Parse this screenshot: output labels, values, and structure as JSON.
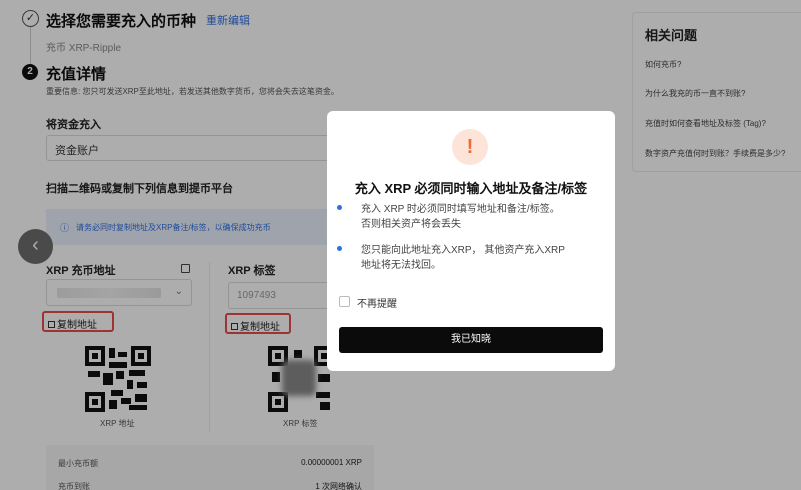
{
  "steps": {
    "step1": {
      "title": "选择您需要充入的币种",
      "edit_link": "重新编辑",
      "selected": "充币 XRP-Ripple"
    },
    "step2": {
      "number": "2",
      "title": "充值详情",
      "notice": "重要信息: 您只可发送XRP至此地址，若发送其他数字货币，您将会失去这笔资金。"
    }
  },
  "deposit_to": {
    "label": "将资金充入",
    "value": "资金账户"
  },
  "scan_label": "扫描二维码或复制下列信息到提币平台",
  "info_banner": "请务必同时复制地址及XRP备注/标签，以确保成功充币",
  "address": {
    "label": "XRP 充币地址",
    "copy_label": "复制地址",
    "qr_caption": "XRP 地址"
  },
  "tag": {
    "label": "XRP 标签",
    "value": "1097493",
    "copy_label": "复制地址",
    "qr_caption": "XRP 标签"
  },
  "limits": {
    "rows": [
      {
        "label": "最小充币额",
        "value": "0.00000001 XRP"
      },
      {
        "label": "充币到账",
        "value": "1 次网络确认"
      }
    ]
  },
  "faq": {
    "title": "相关问题",
    "items": [
      "如何充币?",
      "为什么我充的币一直不到账?",
      "充值时如何查看地址及标签 (Tag)?",
      "数字资产充值何时到账？手续费是多少?"
    ]
  },
  "modal": {
    "title": "充入 XRP 必须同时输入地址及备注/标签",
    "bullets": [
      {
        "line1": "充入 XRP 时必须同时填写地址和备注/标签。",
        "line2": "否则相关资产将会丢失"
      },
      {
        "line1": "您只能向此地址充入XRP， 其他资产充入XRP",
        "line2": "地址将无法找回。"
      }
    ],
    "checkbox_label": "不再提醒",
    "confirm_label": "我已知晓",
    "warning_glyph": "!"
  },
  "colors": {
    "accent": "#2f6fe4",
    "highlight_red": "#e74c4c",
    "warning_orange": "#ef6b3a",
    "button_dark": "#0b0b0b"
  },
  "icons": [
    "check-icon",
    "back-chevron-icon",
    "info-icon",
    "copy-icon",
    "chevron-down-icon",
    "warning-icon"
  ]
}
